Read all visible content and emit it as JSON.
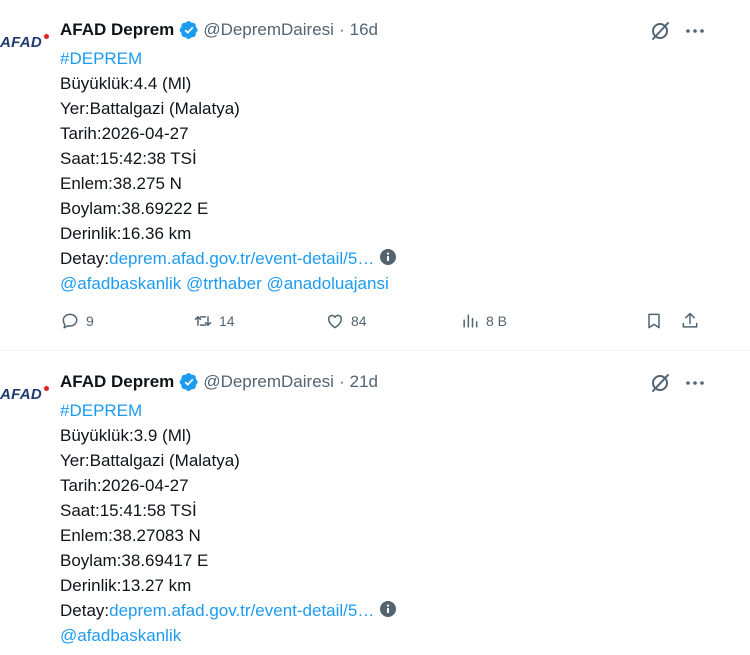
{
  "tweets": [
    {
      "account_name": "AFAD Deprem",
      "avatar_text": "AFAD",
      "handle": "@DepremDairesi",
      "separator": "·",
      "time": "16d",
      "hashtag": "#DEPREM",
      "lines": [
        "Büyüklük:4.4 (Ml)",
        "Yer:Battalgazi (Malatya)",
        "Tarih:2026-04-27",
        "Saat:15:42:38 TSİ",
        "Enlem:38.275 N",
        "Boylam:38.69222 E",
        "Derinlik:16.36 km"
      ],
      "detail_label": "Detay:",
      "detail_link": "deprem.afad.gov.tr/event-detail/5…",
      "mentions": [
        "@afadbaskanlik",
        "@trthaber",
        "@anadoluajansi"
      ],
      "stats": {
        "replies": "9",
        "retweets": "14",
        "likes": "84",
        "views": "8 B"
      }
    },
    {
      "account_name": "AFAD Deprem",
      "avatar_text": "AFAD",
      "handle": "@DepremDairesi",
      "separator": "·",
      "time": "21d",
      "hashtag": "#DEPREM",
      "lines": [
        "Büyüklük:3.9 (Ml)",
        "Yer:Battalgazi (Malatya)",
        "Tarih:2026-04-27",
        "Saat:15:41:58 TSİ",
        "Enlem:38.27083 N",
        "Boylam:38.69417 E",
        "Derinlik:13.27 km"
      ],
      "detail_label": "Detay:",
      "detail_link": "deprem.afad.gov.tr/event-detail/5…",
      "mentions": [
        "@afadbaskanlik"
      ]
    }
  ],
  "colors": {
    "link": "#1d9bf0",
    "verified": "#1d9bf0",
    "muted": "#536471",
    "text": "#0f1419",
    "avatar": "#1d3a6e",
    "avatar_dot": "#e2231a"
  },
  "icons": [
    "verified-badge-icon",
    "grok-icon",
    "more-icon",
    "info-icon",
    "reply-icon",
    "retweet-icon",
    "like-icon",
    "views-icon",
    "bookmark-icon",
    "share-icon"
  ]
}
